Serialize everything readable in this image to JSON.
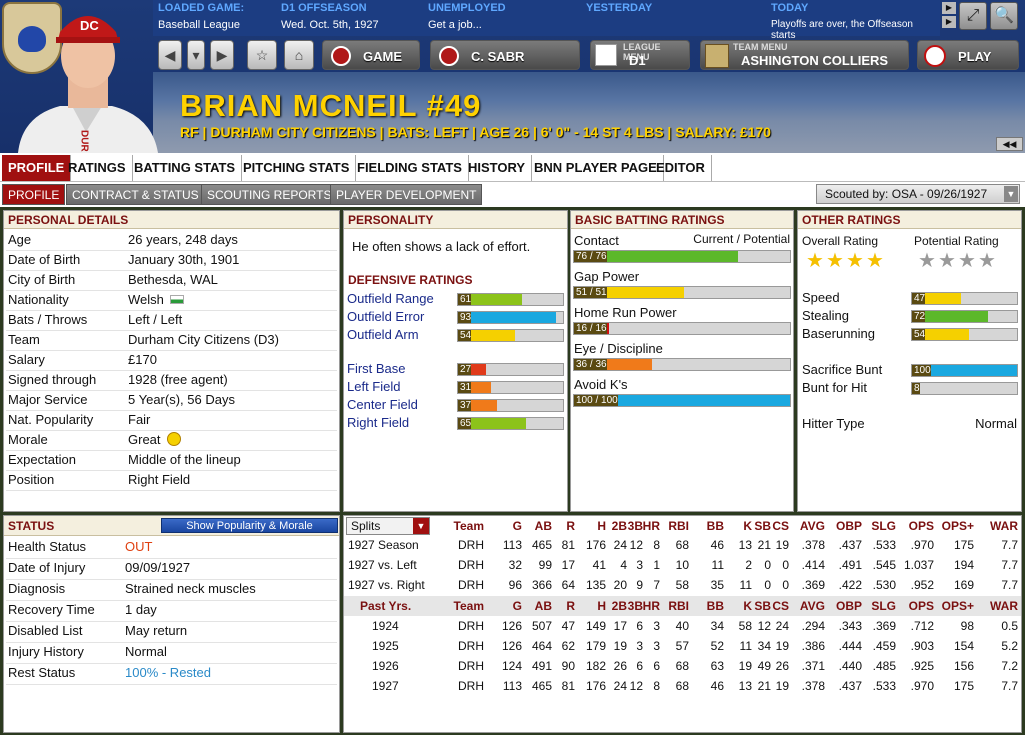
{
  "header": {
    "loaded_game_label": "LOADED GAME:",
    "loaded_game_value": "Baseball League",
    "phase_label": "D1 OFFSEASON",
    "phase_value": "Wed. Oct. 5th, 1927",
    "status_label": "UNEMPLOYED",
    "status_value": "Get a job...",
    "yesterday_label": "YESTERDAY",
    "today_label": "TODAY",
    "today_value": "Playoffs are over, the Offseason starts",
    "game_button": "GAME",
    "manager_button": "C. SABR",
    "league_menu_label": "LEAGUE MENU",
    "league_menu_value": "D1",
    "team_menu_label": "TEAM MENU",
    "team_menu_value": "ASHINGTON COLLIERS",
    "play_button": "PLAY"
  },
  "player": {
    "name": "BRIAN MCNEIL  #49",
    "subtitle": "RF | DURHAM CITY CITIZENS | BATS: LEFT | AGE 26 | 6' 0\" - 14 ST 4 LBS | SALARY: £170",
    "cap_letters": "DC",
    "jersey_letters": "DUR"
  },
  "tabs": [
    "PROFILE",
    "RATINGS",
    "BATTING STATS",
    "PITCHING STATS",
    "FIELDING STATS",
    "HISTORY",
    "BNN PLAYER PAGE",
    "EDITOR"
  ],
  "subtabs": [
    "PROFILE",
    "CONTRACT & STATUS",
    "SCOUTING REPORTS",
    "PLAYER DEVELOPMENT"
  ],
  "scouted_by": "Scouted by: OSA - 09/26/1927",
  "personal": {
    "title": "PERSONAL DETAILS",
    "rows": [
      {
        "label": "Age",
        "value": "26 years, 248 days"
      },
      {
        "label": "Date of Birth",
        "value": "January 30th, 1901"
      },
      {
        "label": "City of Birth",
        "value": "Bethesda, WAL"
      },
      {
        "label": "Nationality",
        "value": "Welsh"
      },
      {
        "label": "Bats / Throws",
        "value": "Left / Left"
      },
      {
        "label": "Team",
        "value": "Durham City Citizens (D3)"
      },
      {
        "label": "Salary",
        "value": "£170"
      },
      {
        "label": "Signed through",
        "value": "1928 (free agent)"
      },
      {
        "label": "Major Service",
        "value": "5 Year(s), 56 Days"
      },
      {
        "label": "Nat. Popularity",
        "value": "Fair"
      },
      {
        "label": "Morale",
        "value": "Great"
      },
      {
        "label": "Expectation",
        "value": "Middle of the lineup"
      },
      {
        "label": "Position",
        "value": "Right Field"
      }
    ]
  },
  "personality": {
    "title": "PERSONALITY",
    "text": "He often shows a lack of effort."
  },
  "defensive": {
    "title": "DEFENSIVE RATINGS",
    "rows": [
      {
        "label": "Outfield Range",
        "value": 61,
        "color": "#8cc31a"
      },
      {
        "label": "Outfield Error",
        "value": 93,
        "color": "#1aa8e0"
      },
      {
        "label": "Outfield Arm",
        "value": 54,
        "color": "#f5d000"
      },
      {
        "label": "First Base",
        "value": 27,
        "color": "#e03a1a"
      },
      {
        "label": "Left Field",
        "value": 31,
        "color": "#f07a1a"
      },
      {
        "label": "Center Field",
        "value": 37,
        "color": "#f07a1a"
      },
      {
        "label": "Right Field",
        "value": 65,
        "color": "#8cc31a"
      }
    ]
  },
  "batting": {
    "title": "BASIC BATTING RATINGS",
    "header": "Current / Potential",
    "rows": [
      {
        "label": "Contact",
        "value": 76,
        "text": "76 / 76",
        "color": "#5cb82a"
      },
      {
        "label": "Gap Power",
        "value": 51,
        "text": "51 / 51",
        "color": "#f5d000"
      },
      {
        "label": "Home Run Power",
        "value": 16,
        "text": "16 / 16",
        "color": "#d01010"
      },
      {
        "label": "Eye / Discipline",
        "value": 36,
        "text": "36 / 36",
        "color": "#f07a1a"
      },
      {
        "label": "Avoid K's",
        "value": 100,
        "text": "100 / 100",
        "color": "#1aa8e0"
      }
    ]
  },
  "other": {
    "title": "OTHER RATINGS",
    "overall_label": "Overall Rating",
    "potential_label": "Potential Rating",
    "overall_stars": 4,
    "potential_stars": 4,
    "rows": [
      {
        "label": "Speed",
        "value": 47,
        "color": "#f5d000"
      },
      {
        "label": "Stealing",
        "value": 72,
        "color": "#5cb82a"
      },
      {
        "label": "Baserunning",
        "value": 54,
        "color": "#f5d000"
      },
      {
        "label": "Sacrifice Bunt",
        "value": 100,
        "color": "#1aa8e0"
      },
      {
        "label": "Bunt for Hit",
        "value": 8,
        "color": "#d01010"
      }
    ],
    "hitter_type_label": "Hitter Type",
    "hitter_type_value": "Normal"
  },
  "status": {
    "title": "STATUS",
    "button": "Show Popularity & Morale",
    "rows": [
      {
        "label": "Health Status",
        "value": "OUT",
        "color": "#e04010"
      },
      {
        "label": "Date of Injury",
        "value": "09/09/1927",
        "color": "#111"
      },
      {
        "label": "Diagnosis",
        "value": "Strained neck muscles",
        "color": "#111"
      },
      {
        "label": "Recovery Time",
        "value": "1 day",
        "color": "#111"
      },
      {
        "label": "Disabled List",
        "value": "May return",
        "color": "#111"
      },
      {
        "label": "Injury History",
        "value": "Normal",
        "color": "#111"
      },
      {
        "label": "Rest Status",
        "value": "100% - Rested",
        "color": "#2a8ac8"
      }
    ]
  },
  "stats": {
    "splits_label": "Splits",
    "columns": [
      "Team",
      "G",
      "AB",
      "R",
      "H",
      "2B",
      "3B",
      "HR",
      "RBI",
      "BB",
      "K",
      "SB",
      "CS",
      "AVG",
      "OBP",
      "SLG",
      "OPS",
      "OPS+",
      "WAR"
    ],
    "split_rows": [
      [
        "1927 Season",
        "DRH",
        "113",
        "465",
        "81",
        "176",
        "24",
        "12",
        "8",
        "68",
        "46",
        "13",
        "21",
        "19",
        ".378",
        ".437",
        ".533",
        ".970",
        "175",
        "7.7"
      ],
      [
        "1927 vs. Left",
        "DRH",
        "32",
        "99",
        "17",
        "41",
        "4",
        "3",
        "1",
        "10",
        "11",
        "2",
        "0",
        "0",
        ".414",
        ".491",
        ".545",
        "1.037",
        "194",
        "7.7"
      ],
      [
        "1927 vs. Right",
        "DRH",
        "96",
        "366",
        "64",
        "135",
        "20",
        "9",
        "7",
        "58",
        "35",
        "11",
        "0",
        "0",
        ".369",
        ".422",
        ".530",
        ".952",
        "169",
        "7.7"
      ]
    ],
    "past_label": "Past Yrs.",
    "past_rows": [
      [
        "1924",
        "DRH",
        "126",
        "507",
        "47",
        "149",
        "17",
        "6",
        "3",
        "40",
        "34",
        "58",
        "12",
        "24",
        ".294",
        ".343",
        ".369",
        ".712",
        "98",
        "0.5"
      ],
      [
        "1925",
        "DRH",
        "126",
        "464",
        "62",
        "179",
        "19",
        "3",
        "3",
        "57",
        "52",
        "11",
        "34",
        "19",
        ".386",
        ".444",
        ".459",
        ".903",
        "154",
        "5.2"
      ],
      [
        "1926",
        "DRH",
        "124",
        "491",
        "90",
        "182",
        "26",
        "6",
        "6",
        "68",
        "63",
        "19",
        "49",
        "26",
        ".371",
        ".440",
        ".485",
        ".925",
        "156",
        "7.2"
      ],
      [
        "1927",
        "DRH",
        "113",
        "465",
        "81",
        "176",
        "24",
        "12",
        "8",
        "68",
        "46",
        "13",
        "21",
        "19",
        ".378",
        ".437",
        ".533",
        ".970",
        "175",
        "7.7"
      ]
    ]
  }
}
